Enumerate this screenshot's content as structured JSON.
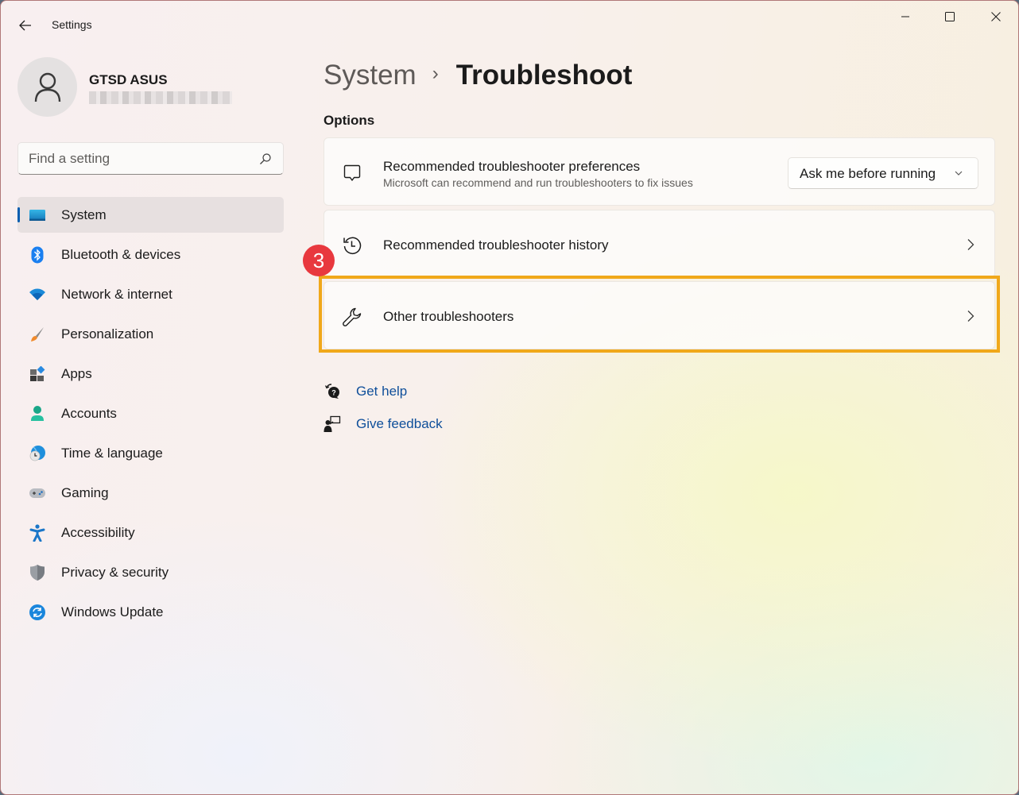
{
  "window": {
    "title": "Settings",
    "controls": {
      "minimize": "minimize",
      "maximize": "maximize",
      "close": "close"
    }
  },
  "user": {
    "name": "GTSD ASUS",
    "email_redacted": true
  },
  "search": {
    "placeholder": "Find a setting",
    "value": ""
  },
  "sidebar": {
    "items": [
      {
        "label": "System",
        "icon": "system-display-icon",
        "active": true
      },
      {
        "label": "Bluetooth & devices",
        "icon": "bluetooth-icon",
        "active": false
      },
      {
        "label": "Network & internet",
        "icon": "wifi-icon",
        "active": false
      },
      {
        "label": "Personalization",
        "icon": "paintbrush-icon",
        "active": false
      },
      {
        "label": "Apps",
        "icon": "apps-icon",
        "active": false
      },
      {
        "label": "Accounts",
        "icon": "account-icon",
        "active": false
      },
      {
        "label": "Time & language",
        "icon": "globe-clock-icon",
        "active": false
      },
      {
        "label": "Gaming",
        "icon": "gamepad-icon",
        "active": false
      },
      {
        "label": "Accessibility",
        "icon": "accessibility-icon",
        "active": false
      },
      {
        "label": "Privacy & security",
        "icon": "shield-icon",
        "active": false
      },
      {
        "label": "Windows Update",
        "icon": "update-icon",
        "active": false
      }
    ]
  },
  "main": {
    "breadcrumb": {
      "parent": "System",
      "separator": "›",
      "current": "Troubleshoot"
    },
    "section_title": "Options",
    "cards": [
      {
        "title": "Recommended troubleshooter preferences",
        "subtitle": "Microsoft can recommend and run troubleshooters to fix issues",
        "icon": "chat-bubble-icon",
        "control": {
          "type": "dropdown",
          "selected": "Ask me before running"
        }
      },
      {
        "title": "Recommended troubleshooter history",
        "icon": "history-icon",
        "control": {
          "type": "chevron"
        }
      },
      {
        "title": "Other troubleshooters",
        "icon": "wrench-icon",
        "control": {
          "type": "chevron"
        },
        "highlighted": true
      }
    ],
    "links": [
      {
        "label": "Get help",
        "icon": "help-icon"
      },
      {
        "label": "Give feedback",
        "icon": "feedback-icon"
      }
    ]
  },
  "annotation": {
    "step_number": "3",
    "highlight_color": "#f0a81a",
    "badge_color": "#e8383e"
  },
  "colors": {
    "accent": "#0a5eb0",
    "link": "#0f4f9a"
  }
}
